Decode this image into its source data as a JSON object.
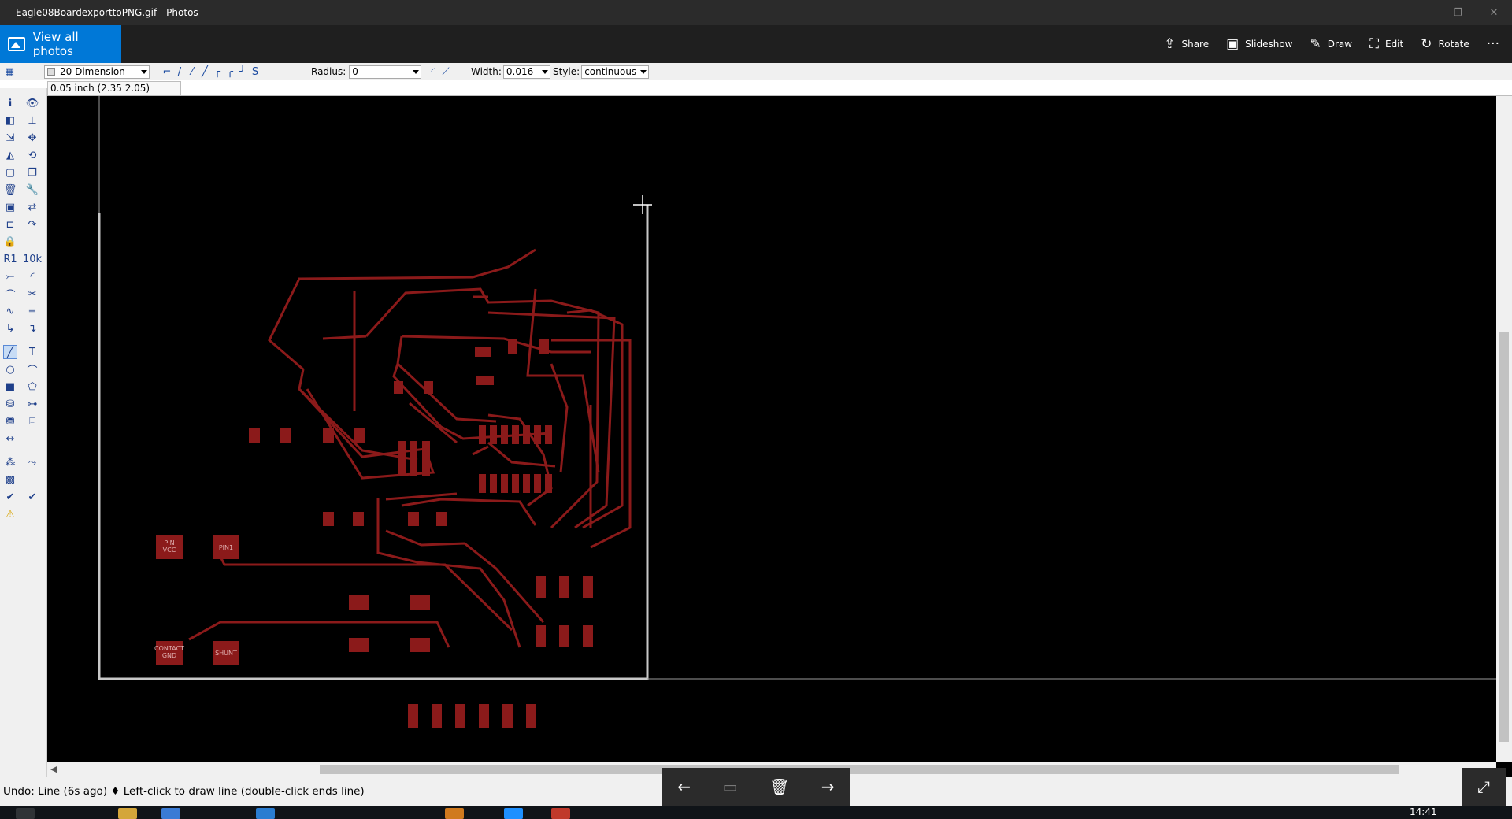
{
  "window": {
    "title": "Eagle08BoardexporttoPNG.gif - Photos",
    "controls": [
      "—",
      "❐",
      "✕"
    ]
  },
  "photos": {
    "view_all_label": "View all photos",
    "actions": [
      {
        "icon": "share-icon",
        "glyph": "⇪",
        "label": "Share"
      },
      {
        "icon": "slideshow-icon",
        "glyph": "▣",
        "label": "Slideshow"
      },
      {
        "icon": "draw-icon",
        "glyph": "✎",
        "label": "Draw"
      },
      {
        "icon": "edit-icon",
        "glyph": "⛶",
        "label": "Edit"
      },
      {
        "icon": "rotate-icon",
        "glyph": "↻",
        "label": "Rotate"
      }
    ],
    "more_label": "···",
    "nav": {
      "prev": "←",
      "fit": "▭",
      "delete": "🗑",
      "next": "→",
      "expand": "⤢"
    }
  },
  "eagle": {
    "layer_combo": "20 Dimension",
    "radius_label": "Radius:",
    "radius_value": "0",
    "width_label": "Width:",
    "width_value": "0.016",
    "style_label": "Style:",
    "style_value": "continuous",
    "coordinate": "0.05 inch (2.35 2.05)",
    "status": "Undo: Line (6s ago)  ♦ Left-click to draw line (double-click ends line)"
  },
  "board": {
    "labels": {
      "pin_vcc_1": "PIN",
      "pin_vcc_2": "VCC",
      "pin1": "PIN1",
      "contact_1": "CONTACT",
      "contact_2": "GND",
      "shunt": "SHUNT"
    },
    "copper_color": "#8b1a1a",
    "outline_color": "#c8c8c8"
  },
  "taskbar": {
    "clock": "14:41"
  }
}
